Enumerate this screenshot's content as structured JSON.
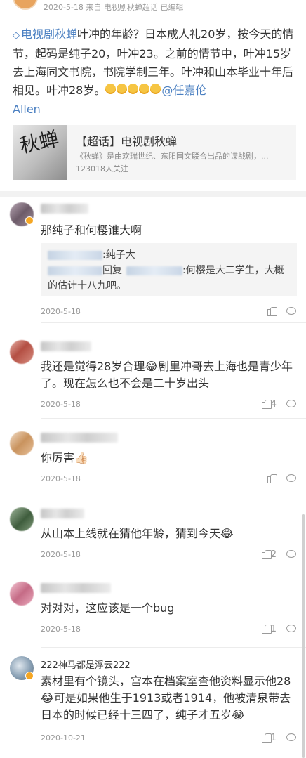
{
  "post": {
    "meta": "2020-5-18  来自 电视剧秋蝉超话 已编辑",
    "topic_icon": "◇",
    "topic": "电视剧秋蝉",
    "body": "叶冲的年龄？日本成人礼20岁，按今天的情节，起码是纯子20，叶冲23。之前的情节中，叶冲15岁去上海同文书院，书院学制三年。叶冲和山本毕业十年后相见。叶冲28岁。",
    "mention_handle": "@任嘉伦",
    "mention_tail": "Allen",
    "card": {
      "thumb_text": "秋蝉",
      "title": "【超话】电视剧秋蝉",
      "desc": "《秋蝉》是由欢瑞世纪、东阳国文联合出品的谍战剧，...",
      "follow": "123018人关注"
    }
  },
  "comments": [
    {
      "text": "那纯子和何樱谁大啊",
      "reply_line1_tail": ":纯子大",
      "reply_line2_prefix": "回复",
      "reply_line2_tail": ":何樱是大二学生，大概",
      "reply_line3": "的估计十八九吧。",
      "date": "2020-5-18",
      "likes": "",
      "avatar_color": "#7d6f7a"
    },
    {
      "text": "我还是觉得28岁合理😂剧里冲哥去上海也是青少年了。现在怎么也不会是二十岁出头",
      "date": "2020-5-18",
      "likes": "4",
      "avatar_color": "#c66b5f"
    },
    {
      "text": "你厉害👍🏻",
      "date": "2020-5-18",
      "likes": "",
      "avatar_color": "#d9b28a"
    },
    {
      "text": "从山本上线就在猜他年龄，猜到今天😂",
      "date": "2020-5-18",
      "likes": "2",
      "avatar_color": "#5c7a5a"
    },
    {
      "text": "对对对，这应该是一个bug",
      "date": "2020-5-18",
      "likes": "1",
      "avatar_color": "#d68aa0"
    },
    {
      "name": "222神马都是浮云222",
      "text": "素材里有个镜头，宫本在档案室查他资料显示他28😂可是如果他生于1913或者1914，他被清泉带去日本的时候已经十三四了，纯子才五岁😂",
      "date": "2020-10-21",
      "likes": "1",
      "avatar_color": "#6f8aa3"
    }
  ]
}
